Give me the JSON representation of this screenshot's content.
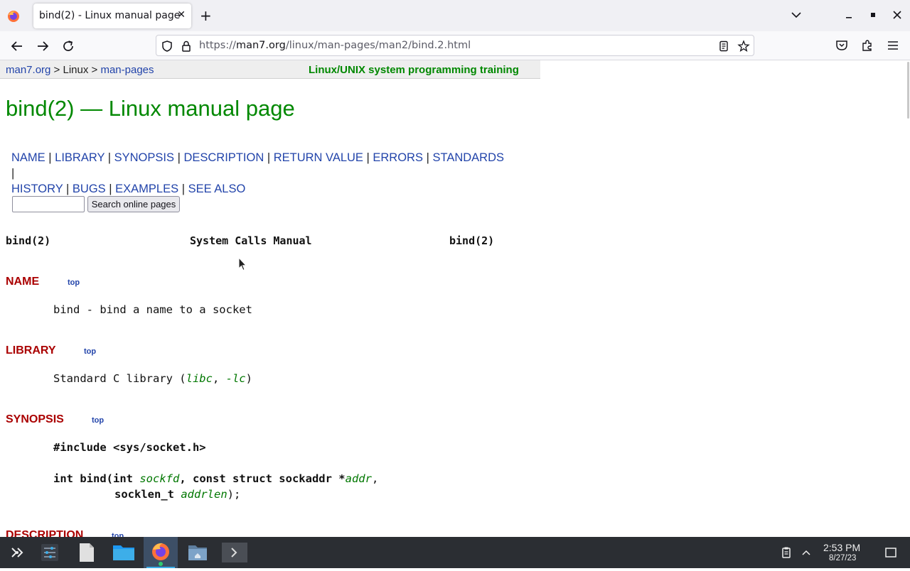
{
  "browser": {
    "tab_title": "bind(2) - Linux manual page",
    "tab_close": "✕",
    "new_tab": "+",
    "url_scheme": "https://",
    "url_domain": "man7.org",
    "url_path": "/linux/man-pages/man2/bind.2.html",
    "icons": [
      "firefox-icon",
      "back-icon",
      "forward-icon",
      "reload-icon",
      "shield-icon",
      "lock-icon",
      "reader-view-icon",
      "bookmark-star-icon",
      "pocket-icon",
      "extensions-icon",
      "menu-icon",
      "tab-list-icon",
      "minimize-icon",
      "maximize-icon",
      "close-icon"
    ]
  },
  "page": {
    "breadcrumb": {
      "home": "man7.org",
      "sep1": " > ",
      "linux": "Linux",
      "sep2": " > ",
      "manpages": "man-pages"
    },
    "training_link": "Linux/UNIX system programming training",
    "title": "bind(2) — Linux manual page",
    "section_nav": [
      "NAME",
      "LIBRARY",
      "SYNOPSIS",
      "DESCRIPTION",
      "RETURN VALUE",
      "ERRORS",
      "STANDARDS",
      "HISTORY",
      "BUGS",
      "EXAMPLES",
      "SEE ALSO"
    ],
    "nav_sep": " | ",
    "search_value": "",
    "search_button": "Search online pages",
    "header_left": "bind(2)",
    "header_center": "System Calls Manual",
    "header_right": "bind(2)",
    "top_label": "top",
    "sections": {
      "name_heading": "NAME",
      "name_text": "bind - bind a name to a socket",
      "library_heading": "LIBRARY",
      "library_prefix": "Standard C library (",
      "library_libc": "libc",
      "library_comma": ", ",
      "library_lc": "-lc",
      "library_suffix": ")",
      "synopsis_heading": "SYNOPSIS",
      "synopsis_include": "#include <sys/socket.h>",
      "synopsis_sig_1": "int bind(int ",
      "synopsis_sockfd": "sockfd",
      "synopsis_sig_2": ", const struct sockaddr *",
      "synopsis_addr": "addr",
      "synopsis_sig_3": ",",
      "synopsis_sig_4": "socklen_t ",
      "synopsis_addrlen": "addrlen",
      "synopsis_sig_5": ");",
      "description_heading": "DESCRIPTION"
    }
  },
  "taskbar": {
    "time": "2:53 PM",
    "date": "8/27/23",
    "items": [
      "application-launcher-icon",
      "system-settings-icon",
      "text-file-icon",
      "file-manager-icon",
      "firefox-icon",
      "home-folder-icon",
      "terminal-icon"
    ],
    "tray": [
      "clipboard-icon",
      "tray-expand-icon",
      "show-desktop-icon"
    ]
  },
  "colors": {
    "heading_green": "#008800",
    "section_red": "#aa0000",
    "link_blue": "#2244aa",
    "taskbar_bg": "#2b2e33"
  }
}
